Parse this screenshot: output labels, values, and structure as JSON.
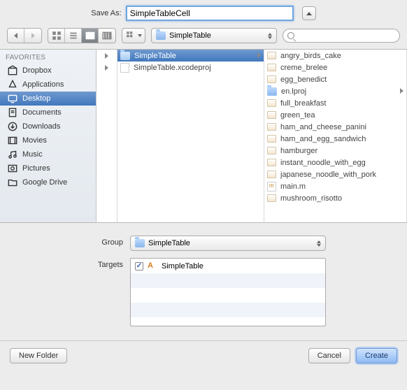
{
  "saveAs": {
    "label": "Save As:",
    "value": "SimpleTableCell"
  },
  "toolbar": {
    "path": "SimpleTable",
    "searchPlaceholder": ""
  },
  "sidebar": {
    "header": "FAVORITES",
    "items": [
      {
        "label": "Dropbox",
        "icon": "box"
      },
      {
        "label": "Applications",
        "icon": "apps"
      },
      {
        "label": "Desktop",
        "icon": "desktop",
        "selected": true
      },
      {
        "label": "Documents",
        "icon": "docs"
      },
      {
        "label": "Downloads",
        "icon": "downloads"
      },
      {
        "label": "Movies",
        "icon": "movies"
      },
      {
        "label": "Music",
        "icon": "music"
      },
      {
        "label": "Pictures",
        "icon": "pictures"
      },
      {
        "label": "Google Drive",
        "icon": "folder"
      }
    ]
  },
  "columns": {
    "mid": [
      {
        "label": "SimpleTable",
        "type": "folder",
        "selected": true,
        "hasArrow": true
      },
      {
        "label": "SimpleTable.xcodeproj",
        "type": "file"
      }
    ],
    "wide": [
      {
        "label": "angry_birds_cake",
        "type": "img"
      },
      {
        "label": "creme_brelee",
        "type": "img"
      },
      {
        "label": "egg_benedict",
        "type": "img"
      },
      {
        "label": "en.lproj",
        "type": "folder",
        "hasArrow": true
      },
      {
        "label": "full_breakfast",
        "type": "img"
      },
      {
        "label": "green_tea",
        "type": "img"
      },
      {
        "label": "ham_and_cheese_panini",
        "type": "img"
      },
      {
        "label": "ham_and_egg_sandwich",
        "type": "img"
      },
      {
        "label": "hamburger",
        "type": "img"
      },
      {
        "label": "instant_noodle_with_egg",
        "type": "img"
      },
      {
        "label": "japanese_noodle_with_pork",
        "type": "img"
      },
      {
        "label": "main.m",
        "type": "m"
      },
      {
        "label": "mushroom_risotto",
        "type": "img"
      }
    ]
  },
  "groupRow": {
    "label": "Group",
    "value": "SimpleTable"
  },
  "targetsRow": {
    "label": "Targets",
    "items": [
      {
        "name": "SimpleTable",
        "checked": true
      }
    ]
  },
  "footer": {
    "newFolder": "New Folder",
    "cancel": "Cancel",
    "create": "Create"
  }
}
